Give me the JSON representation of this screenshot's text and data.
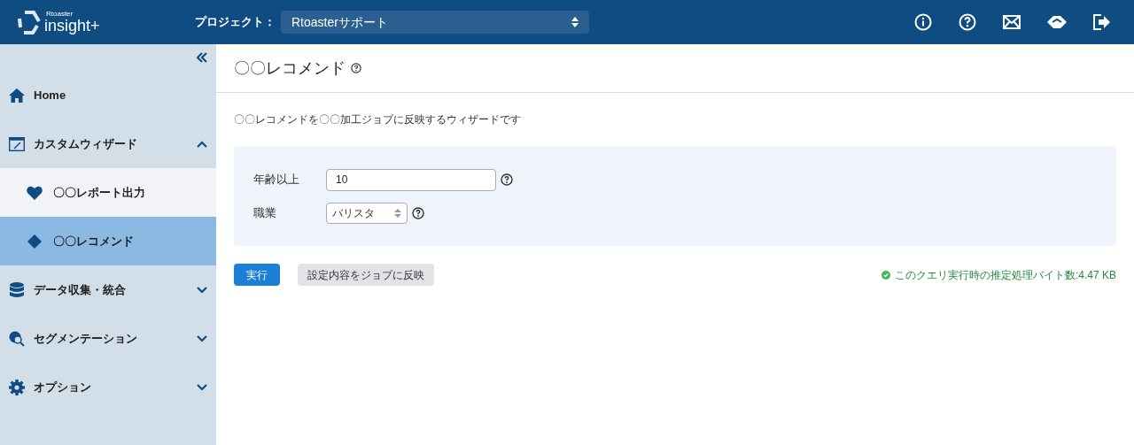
{
  "header": {
    "logo_small": "Rtoaster",
    "logo_main": "insight+",
    "project_label": "プロジェクト：",
    "project": "Rtoasterサポート"
  },
  "sidebar": {
    "items": [
      {
        "kind": "link",
        "label": "Home"
      },
      {
        "kind": "group",
        "label": "カスタムウィザード",
        "expanded": true,
        "children": [
          {
            "label": "〇〇レポート出力",
            "selected": false
          },
          {
            "label": "〇〇レコメンド",
            "selected": true
          }
        ]
      },
      {
        "kind": "group",
        "label": "データ収集・統合",
        "expanded": false
      },
      {
        "kind": "group",
        "label": "セグメンテーション",
        "expanded": false
      },
      {
        "kind": "group",
        "label": "オプション",
        "expanded": false
      }
    ]
  },
  "page": {
    "title": "〇〇レコメンド",
    "description": "〇〇レコメンドを〇〇加工ジョブに反映するウィザードです",
    "fields": [
      {
        "kind": "text",
        "label": "年齢以上",
        "value": "10"
      },
      {
        "kind": "select",
        "label": "職業",
        "value": "バリスタ"
      }
    ],
    "buttons": [
      {
        "kind": "primary",
        "label": "実行"
      },
      {
        "kind": "secondary",
        "label": "設定内容をジョブに反映"
      }
    ],
    "status": "このクエリ実行時の推定処理バイト数:4.47 KB"
  }
}
